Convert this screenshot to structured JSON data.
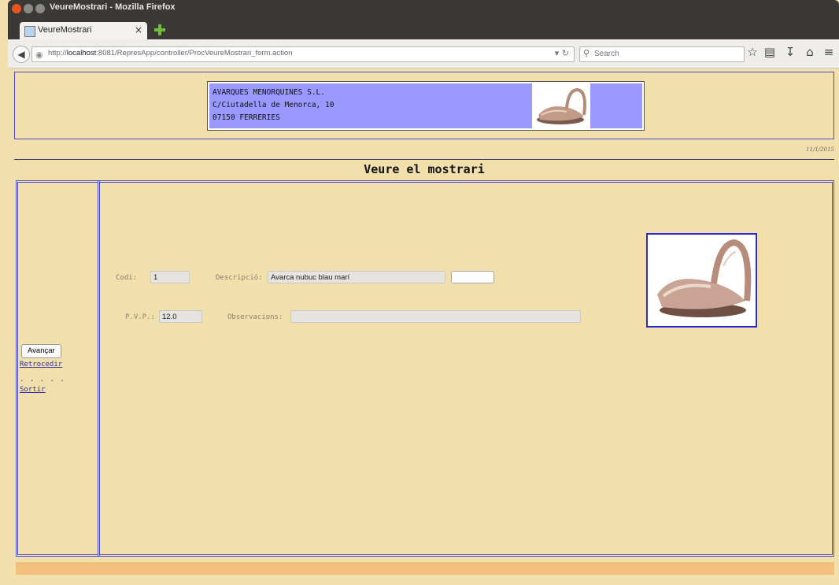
{
  "window": {
    "title": "VeureMostrari - Mozilla Firefox",
    "tab_label": "VeureMostrari",
    "tab_close": "×"
  },
  "navbar": {
    "url_prefix": "http://",
    "url_host": "localhost",
    "url_path": ":8081/RepresApp/controller/ProcVeureMostrari_form.action",
    "search_placeholder": "Search"
  },
  "company": {
    "name": "AVARQUES MENORQUINES S.L.",
    "address": "C/Ciutadella de Menorca, 10",
    "city": "07150 FERRERIES"
  },
  "date": "11/1/2015",
  "page_title": "Veure el mostrari",
  "nav": {
    "avancar": "Avançar",
    "retrocedir": "Retrocedir",
    "dots": ". . . . .",
    "sortir": "Sortir"
  },
  "form": {
    "codi_label": "Codi:",
    "codi_value": "1",
    "descripcio_label": "Descripció:",
    "descripcio_value": "Avarca nubuc blau marí",
    "pvp_label": "P.V.P.:",
    "pvp_value": "12.0",
    "observacions_label": "Observacions:",
    "observacions_value": ""
  },
  "colors": {
    "page_bg": "#f2e0ac",
    "frame_border": "#4a4acc",
    "logo_bg": "#9999ff",
    "footer_bar": "#f4c07e",
    "link": "#2f2fa8"
  },
  "icons": [
    "close-window-icon",
    "minimize-window-icon",
    "maximize-window-icon",
    "new-tab-icon",
    "back-icon",
    "globe-icon",
    "reload-icon",
    "search-icon",
    "bookmark-star-icon",
    "reading-list-icon",
    "download-icon",
    "home-icon",
    "menu-icon"
  ]
}
